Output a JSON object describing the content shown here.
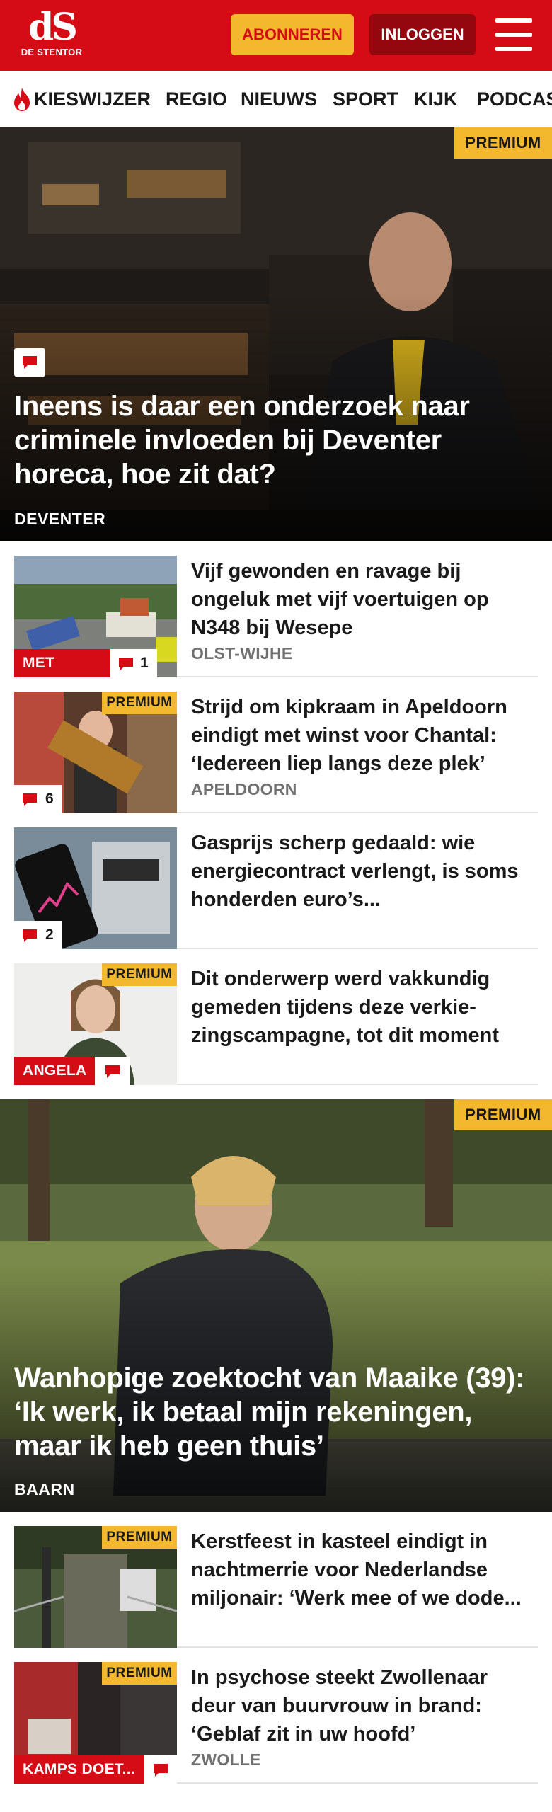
{
  "header": {
    "logo_mark": "dS",
    "logo_name": "DE STENTOR",
    "subscribe_label": "ABONNEREN",
    "login_label": "INLOGGEN"
  },
  "nav": {
    "items": [
      "KIESWIJZER",
      "REGIO",
      "NIEUWS",
      "SPORT",
      "KIJK",
      "PODCAST"
    ]
  },
  "premium_label": "PREMIUM",
  "hero1": {
    "title": "Ineens is daar een onderzoek naar criminele invloeden bij Deventer horeca, hoe zit dat?",
    "location": "DEVENTER"
  },
  "articles": [
    {
      "title": "Vijf gewonden en ravage bij ongeluk met vijf voertuigen op N348 bij Wesepe",
      "location": "OLST-WIJHE",
      "label": "MET VIDEO",
      "comments": "1"
    },
    {
      "title": "Strijd om kipkraam in Apeldoorn eindigt met winst voor Chantal: ‘Iedereen liep langs deze plek’",
      "location": "APELDOORN",
      "comments": "6"
    },
    {
      "title": "Gasprijs scherp gedaald: wie energiecontract verlengt, is soms honderden euro’s...",
      "comments": "2"
    },
    {
      "title": "Dit onderwerp werd vakkundig gemeden tijdens deze verkie­zingscampagne, tot dit moment",
      "label": "ANGELA"
    }
  ],
  "hero2": {
    "title": "Wanhopige zoektocht van Maaike (39): ‘Ik werk, ik betaal mijn rekeningen, maar ik heb geen thuis’",
    "location": "BAARN"
  },
  "articles2": [
    {
      "title": "Kerstfeest in kasteel eindigt in nachtmerrie voor Nederlandse miljonair: ‘Werk mee of we dode..."
    },
    {
      "title": "In psychose steekt Zwollenaar deur van buurvrouw in brand: ‘Geblaf zit in uw hoofd’",
      "location": "ZWOLLE",
      "label": "KAMPS DOET..."
    }
  ],
  "colors": {
    "brand_red": "#d50b16",
    "premium_yellow": "#f4b82e",
    "login_dark_red": "#94070f"
  }
}
